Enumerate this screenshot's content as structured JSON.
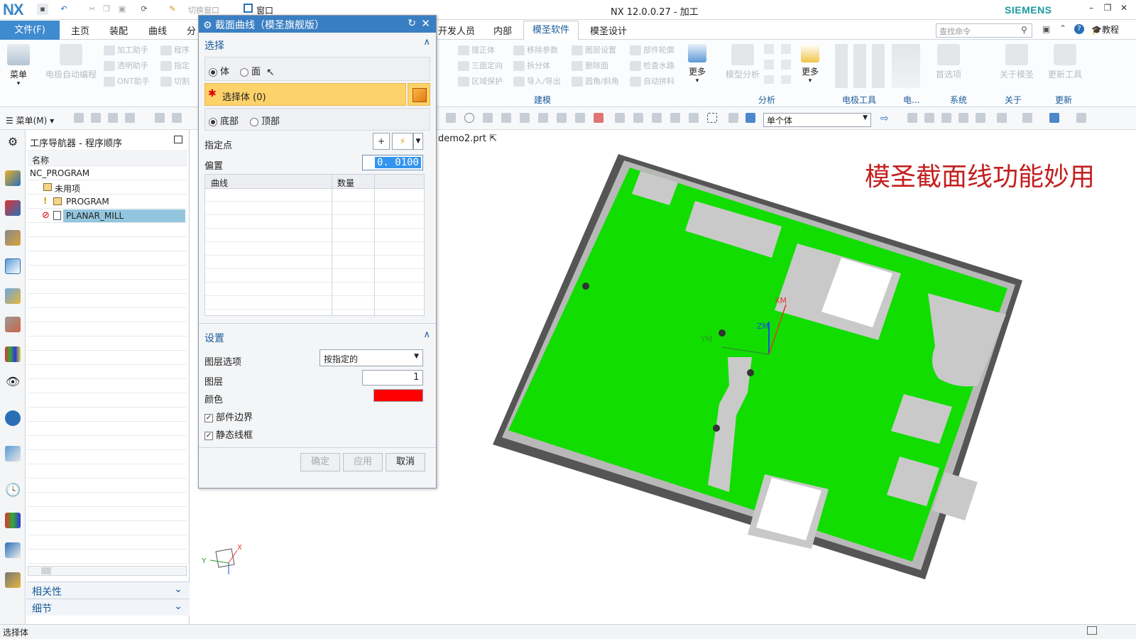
{
  "app": {
    "logo": "NX",
    "window_title": "NX 12.0.0.27 - 加工",
    "brand": "SIEMENS",
    "switch_window": "切换窗口",
    "window_menu": "窗口"
  },
  "menu": {
    "file": "文件(F)",
    "tabs": [
      "主页",
      "装配",
      "曲线",
      "分",
      "开发人员",
      "内部",
      "模圣软件",
      "模圣设计"
    ],
    "search_placeholder": "查找命令",
    "tutorial": "教程"
  },
  "ribbon": {
    "menu_btn": "菜单",
    "ele_auto": "电极自动编程",
    "col1": [
      "加工助手",
      "透明助手",
      "ONT助手"
    ],
    "col2": [
      "程序",
      "指定",
      "切割"
    ],
    "build_col1": [
      "摆正体",
      "三面定向",
      "区域保护"
    ],
    "build_col2": [
      "移除参数",
      "拆分体",
      "导入/导出"
    ],
    "build_col3": [
      "图层设置",
      "删除面",
      "圆角/斜角"
    ],
    "build_col4": [
      "部件轮廓",
      "检查水路",
      "自动拼料"
    ],
    "more1": "更多",
    "model_analysis": "模型分析",
    "more2": "更多",
    "ele_tools": "电极工具",
    "first_item": "首选项",
    "about_ms": "关于模圣",
    "update_tools": "更新工具",
    "groups": {
      "build": "建模",
      "analysis": "分析",
      "ele_tool": "电极工具",
      "ele": "电...",
      "system": "系统",
      "about": "关于",
      "update": "更新"
    }
  },
  "toolbar": {
    "menu_label": "菜单(M)",
    "select_filter": "单个体"
  },
  "navigator": {
    "title": "工序导航器 - 程序顺序",
    "col_name": "名称",
    "items": [
      "NC_PROGRAM",
      "未用项",
      "PROGRAM",
      "PLANAR_MILL"
    ],
    "relevance": "相关性",
    "details": "细节"
  },
  "dialog": {
    "title": "截面曲线（模圣旗舰版）",
    "select_section": "选择",
    "radio_body": "体",
    "radio_face": "面",
    "select_body": "选择体 (0)",
    "radio_bottom": "底部",
    "radio_top": "顶部",
    "specify_point": "指定点",
    "offset_label": "偏置",
    "offset_value": "0. 0100",
    "col_curve": "曲线",
    "col_count": "数量",
    "settings": "设置",
    "layer_option": "图层选项",
    "layer_option_value": "按指定的",
    "layer": "图层",
    "layer_value": "1",
    "color": "颜色",
    "color_value": "#ff0000",
    "part_boundary": "部件边界",
    "static_wireframe": "静态线框",
    "ok": "确定",
    "apply": "应用",
    "cancel": "取消"
  },
  "viewport": {
    "doc_tab": "demo2.prt",
    "overlay_text": "模圣截面线功能妙用",
    "axis": {
      "zm": "ZM",
      "ym": "YM",
      "xm": "XM",
      "x": "X",
      "y": "Y"
    }
  },
  "status": {
    "text": "选择体"
  },
  "colors": {
    "accent": "#3f8bd0",
    "model_green": "#11dd00",
    "overlay_red": "#c31f1f",
    "highlight": "#fdd26a"
  }
}
